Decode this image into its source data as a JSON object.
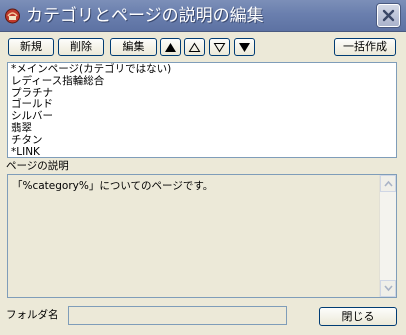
{
  "window": {
    "title": "カテゴリとページの説明の編集"
  },
  "toolbar": {
    "new_label": "新規",
    "delete_label": "削除",
    "edit_label": "編集",
    "bulk_create_label": "一括作成"
  },
  "list": {
    "items": [
      "*メインページ(カテゴリではない)",
      "レディース指輪総合",
      "プラチナ",
      "ゴールド",
      "シルバー",
      "翡翠",
      "チタン",
      "*LINK"
    ]
  },
  "description": {
    "label": "ページの説明",
    "text": "「%category%」についてのページです。"
  },
  "footer": {
    "folder_label": "フォルダ名",
    "folder_value": "",
    "close_label": "閉じる"
  }
}
